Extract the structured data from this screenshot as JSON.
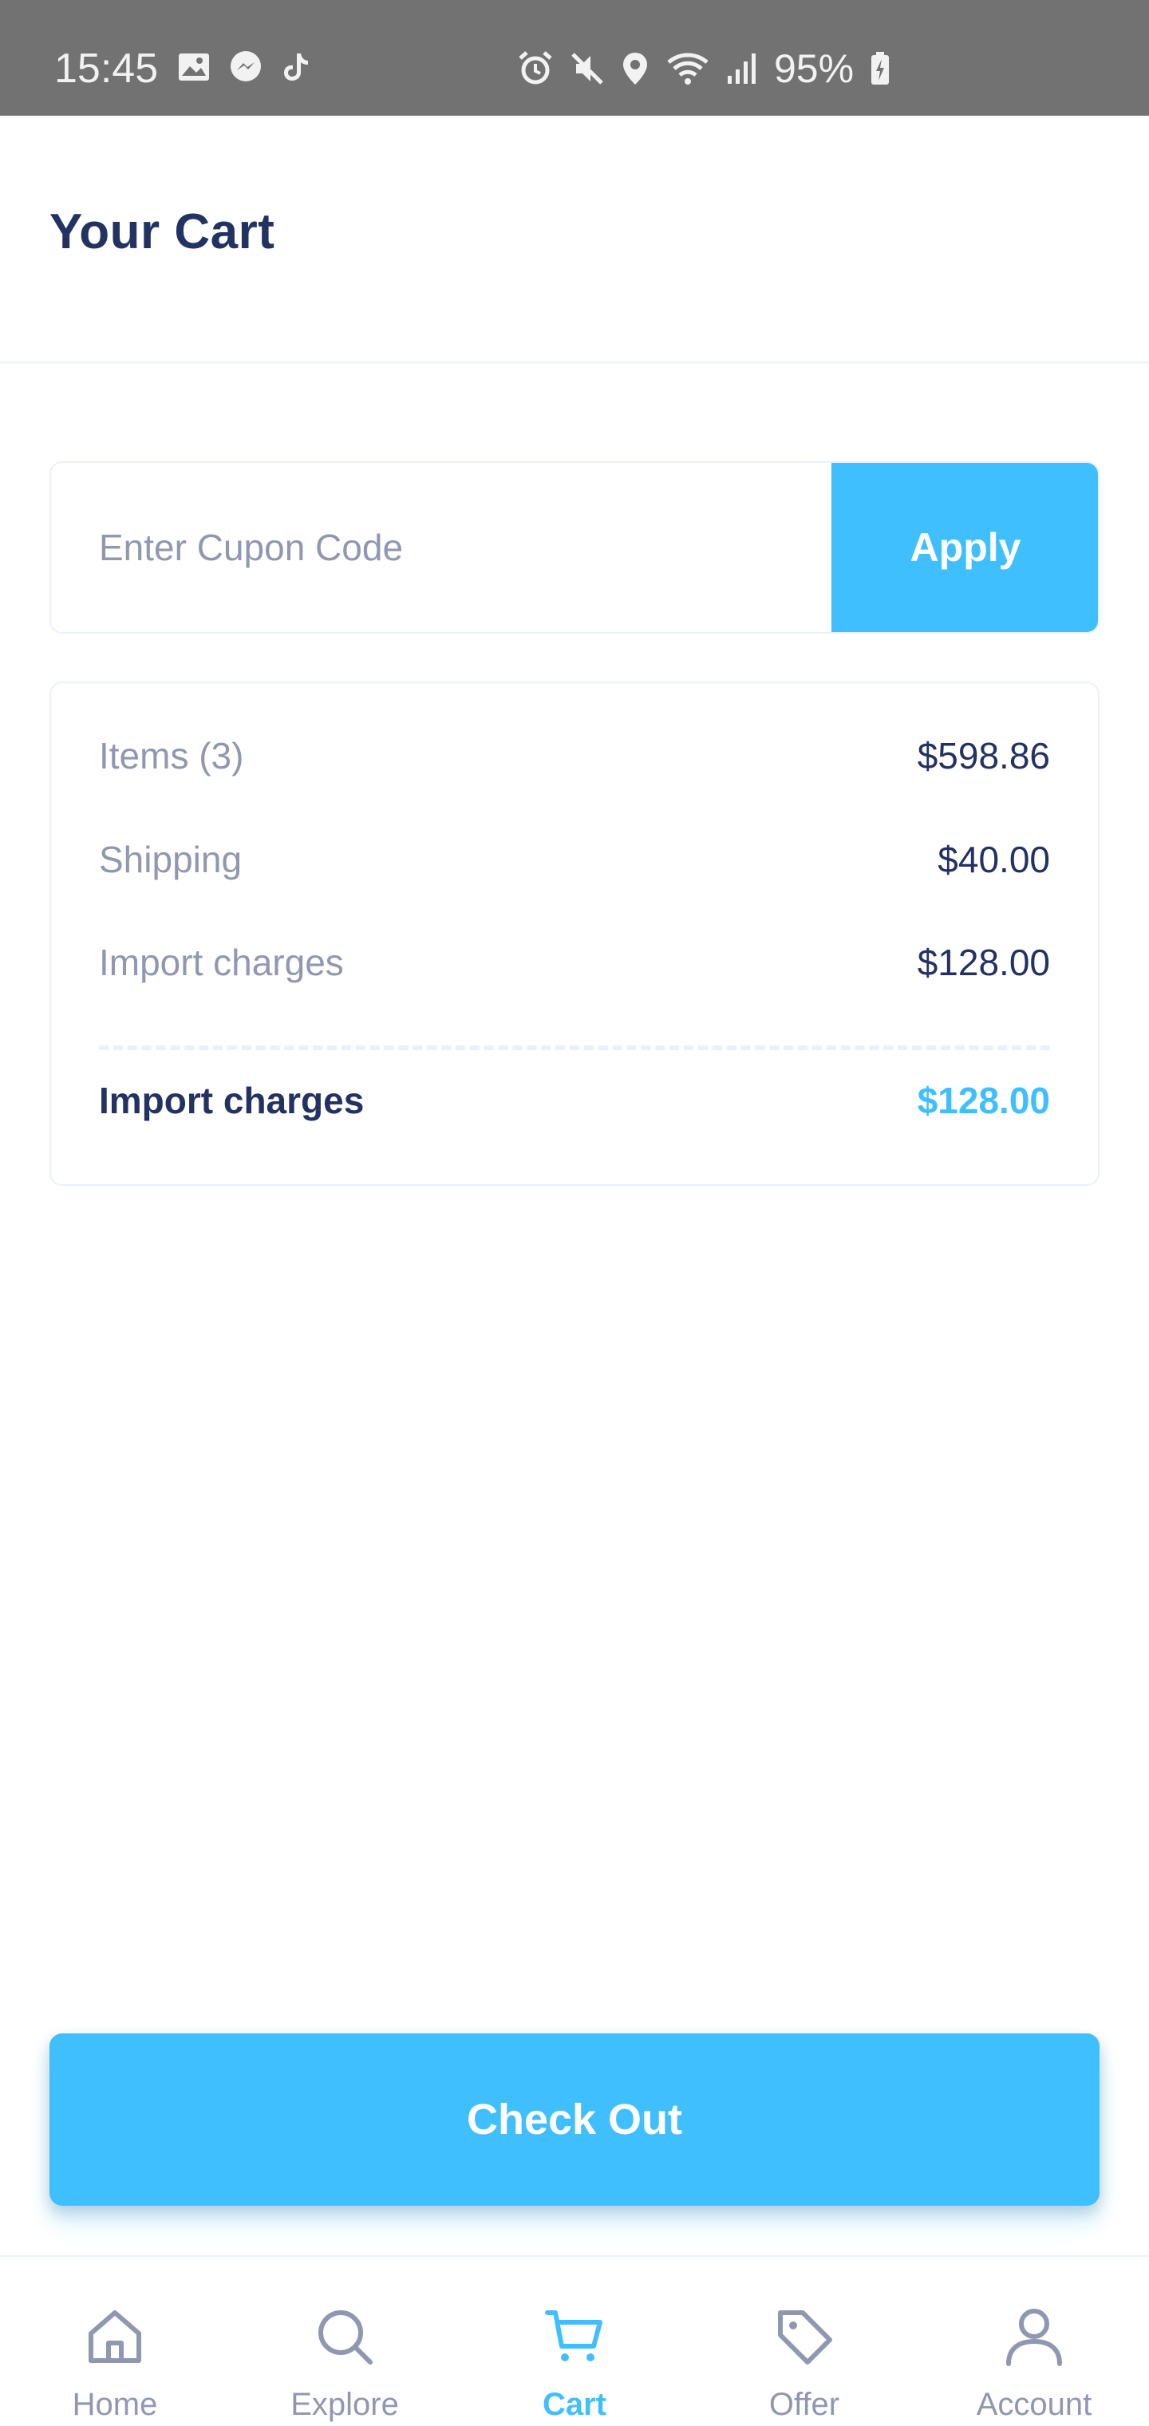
{
  "status_bar": {
    "time": "15:45",
    "battery": "95%",
    "left_icons": [
      "image-icon",
      "messenger-icon",
      "tiktok-icon"
    ],
    "right_icons": [
      "alarm-icon",
      "mute-icon",
      "location-icon",
      "wifi-icon",
      "signal-icon",
      "battery-charging-icon"
    ]
  },
  "header": {
    "title": "Your Cart"
  },
  "coupon": {
    "placeholder": "Enter Cupon Code",
    "value": "",
    "apply_label": "Apply"
  },
  "summary": {
    "rows": [
      {
        "label": "Items (3)",
        "value": "$598.86"
      },
      {
        "label": "Shipping",
        "value": "$40.00"
      },
      {
        "label": "Import charges",
        "value": "$128.00"
      }
    ],
    "total": {
      "label": "Import charges",
      "value": "$128.00"
    }
  },
  "checkout": {
    "label": "Check Out"
  },
  "bottom_nav": {
    "items": [
      {
        "label": "Home",
        "icon": "home-icon",
        "active": false
      },
      {
        "label": "Explore",
        "icon": "search-icon",
        "active": false
      },
      {
        "label": "Cart",
        "icon": "cart-icon",
        "active": true
      },
      {
        "label": "Offer",
        "icon": "tag-icon",
        "active": false
      },
      {
        "label": "Account",
        "icon": "user-icon",
        "active": false
      }
    ]
  },
  "colors": {
    "primary": "#40bfff",
    "text_dark": "#223263",
    "text_grey": "#9098b1",
    "border": "#ebf0ff",
    "status_bar_bg": "#727272"
  }
}
